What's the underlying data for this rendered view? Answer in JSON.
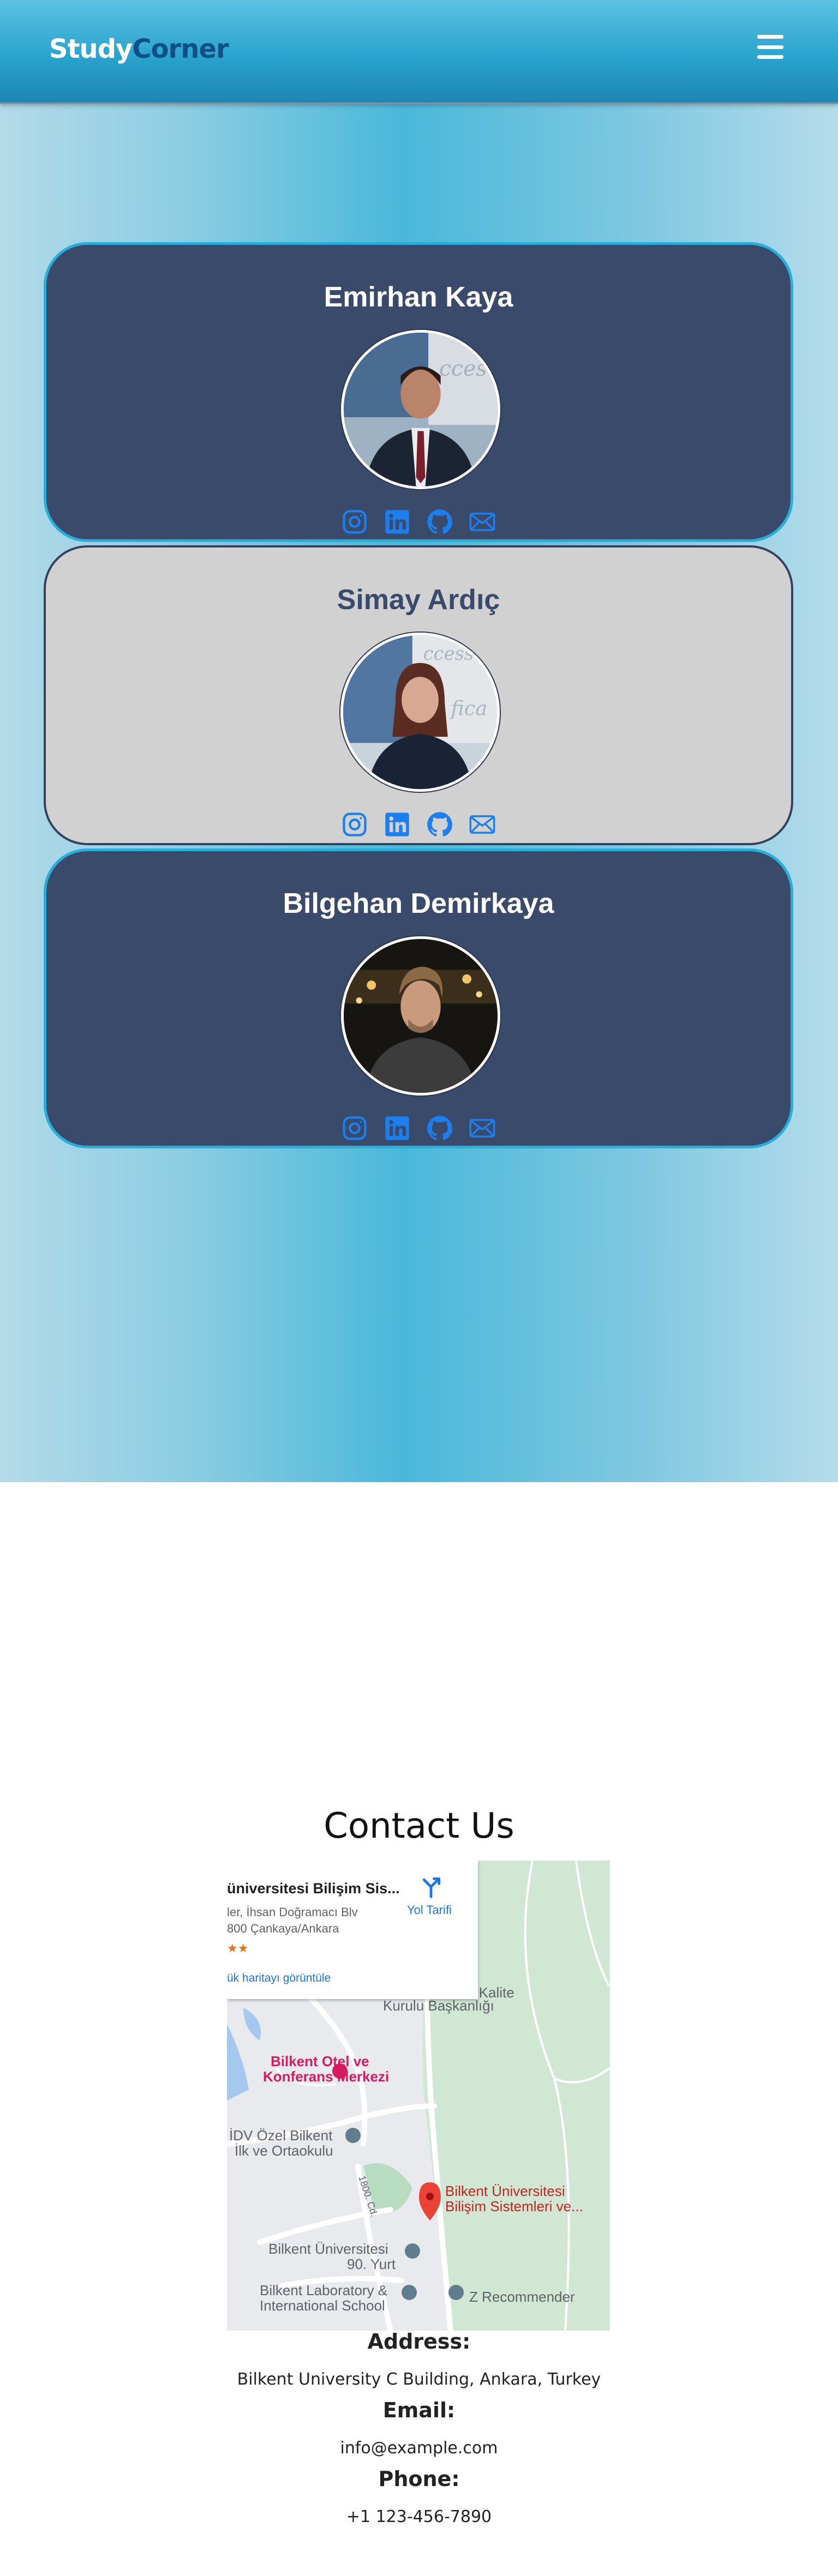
{
  "navbar": {
    "brand_part1": "Study",
    "brand_part2": "Corner"
  },
  "team": [
    {
      "name": "Emirhan Kaya",
      "style": "dark"
    },
    {
      "name": "Simay Ardıç",
      "style": "light"
    },
    {
      "name": "Bilgehan Demirkaya",
      "style": "dark"
    }
  ],
  "social_icons": [
    "instagram-icon",
    "linkedin-icon",
    "github-icon",
    "mail-icon"
  ],
  "contact": {
    "title": "Contact Us",
    "map": {
      "place_name": "üniversitesi Bilişim Sis...",
      "address_line1": "ler, İhsan Doğramacı Blv",
      "address_line2": "800 Çankaya/Ankara",
      "rating_stars": "★★",
      "directions_label": "Yol Tarifi",
      "larger_map_link": "ük haritayı görüntüle",
      "labels": {
        "kalite": "n Kalite",
        "kurulu": "Kurulu Başkanlığı",
        "otel1": "Bilkent Otel ve",
        "otel2": "Konferans Merkezi",
        "idv1": "İDV Özel Bilkent",
        "idv2": "İlk ve Ortaokulu",
        "road": "1800. Cd.",
        "bilisim1": "Bilkent Üniversitesi",
        "bilisim2": "Bilişim Sistemleri ve...",
        "yurt1": "Bilkent Üniversitesi",
        "yurt2": "90. Yurt",
        "lab1": "Bilkent Laboratory &",
        "lab2": "International School",
        "z": "Z Recommender"
      }
    },
    "address_label": "Address:",
    "address_value": "Bilkent University C Building, Ankara, Turkey",
    "email_label": "Email:",
    "email_value": "info@example.com",
    "phone_label": "Phone:",
    "phone_value": "+1 123-456-7890"
  },
  "colors": {
    "card_dark": "#3a4a6a",
    "card_light": "#d1d1d1",
    "card_border_accent": "#26b0d9",
    "social_icon": "#1b7ff0",
    "brand_dark": "#0d4f86"
  }
}
